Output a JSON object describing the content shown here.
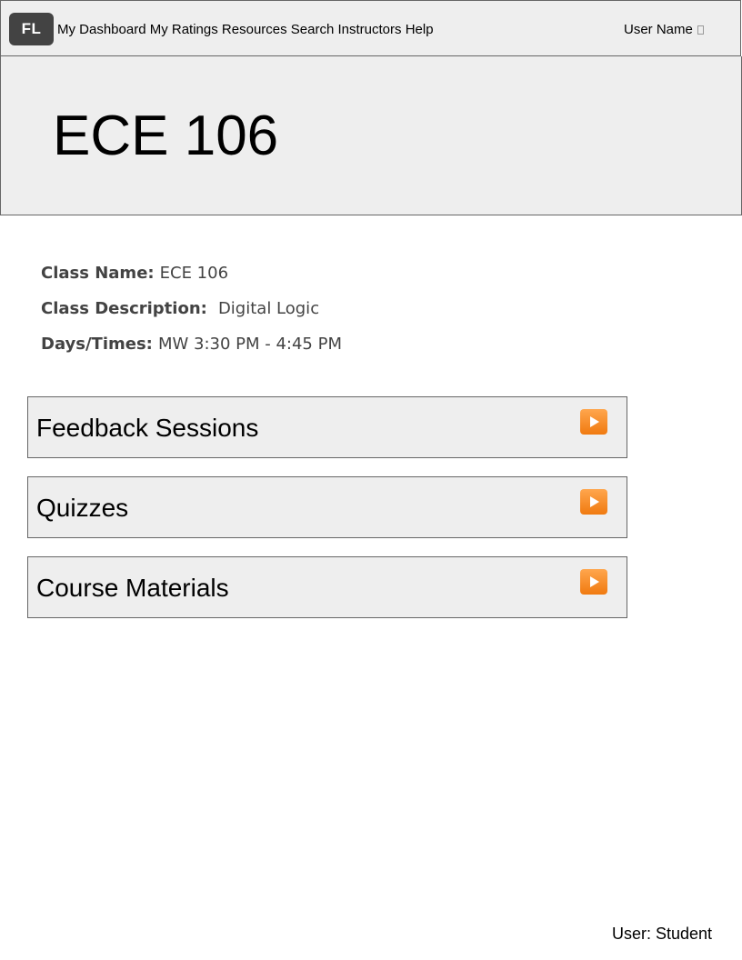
{
  "header": {
    "logo": "FL",
    "nav": [
      "My Dashboard",
      "My Ratings",
      "Resources",
      "Search Instructors",
      "Help"
    ],
    "user_name": "User Name"
  },
  "banner": {
    "title": "ECE 106"
  },
  "class_info": {
    "name_label": "Class Name:",
    "name_value": "ECE 106",
    "description_label": "Class Description:",
    "description_value": "Digital Logic",
    "days_label": "Days/Times:",
    "days_value": "MW 3:30 PM - 4:45 PM"
  },
  "sections": [
    {
      "label": "Feedback Sessions",
      "icon": "play-button-icon"
    },
    {
      "label": "Quizzes",
      "icon": "play-button-icon"
    },
    {
      "label": "Course Materials",
      "icon": "play-button-icon"
    }
  ],
  "footer": {
    "user_role": "User: Student"
  },
  "colors": {
    "panel_bg": "#eeeeee",
    "border": "#666666",
    "logo_bg": "#434343",
    "info_text": "#434343",
    "play_icon": "#f58a1f"
  }
}
